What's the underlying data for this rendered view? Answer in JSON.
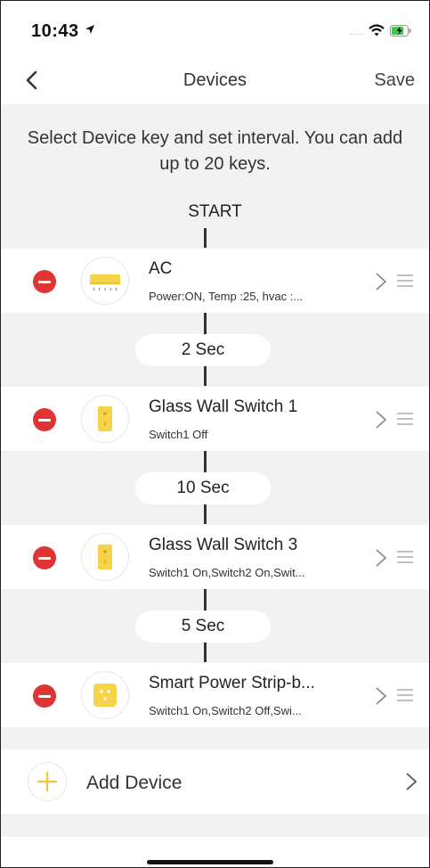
{
  "status_bar": {
    "time": "10:43",
    "signal_text": "....",
    "icons": [
      "location-arrow-icon",
      "wifi-icon",
      "battery-charging-icon"
    ]
  },
  "nav": {
    "title": "Devices",
    "save_label": "Save",
    "back_icon": "chevron-left-icon"
  },
  "instruction": "Select Device key and set interval. You can add up to 20 keys.",
  "start_label": "START",
  "devices": [
    {
      "name": "AC",
      "detail": "Power:ON, Temp :25, hvac :...",
      "icon": "air-conditioner-icon"
    },
    {
      "name": "Glass Wall Switch 1",
      "detail": "Switch1 Off",
      "icon": "wall-switch-icon"
    },
    {
      "name": "Glass Wall Switch 3",
      "detail": "Switch1 On,Switch2 On,Swit...",
      "icon": "wall-switch-icon"
    },
    {
      "name": "Smart Power Strip-b...",
      "detail": "Switch1 On,Switch2 Off,Swi...",
      "icon": "power-strip-icon"
    }
  ],
  "intervals": [
    "2 Sec",
    "10 Sec",
    "5 Sec"
  ],
  "add_device": {
    "label": "Add Device",
    "icon": "plus-icon"
  },
  "colors": {
    "remove": "#e03434",
    "device_yellow": "#f5d547",
    "background": "#f2f2f2"
  }
}
